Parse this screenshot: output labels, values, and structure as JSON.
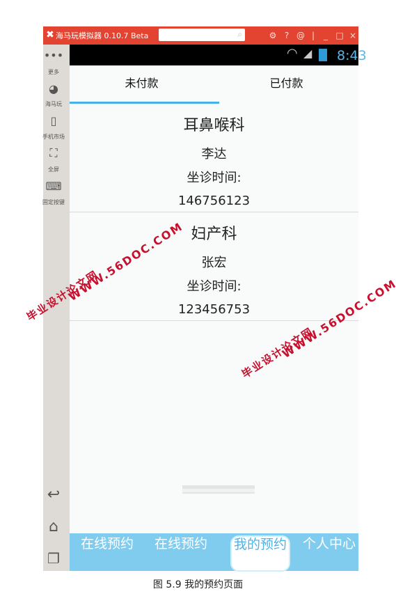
{
  "emulator": {
    "title": "海马玩模拟器 0.10.7 Beta",
    "search_placeholder": "",
    "controls": [
      "⚙",
      "?",
      "@",
      "|",
      "_",
      "□",
      "×"
    ],
    "rail": [
      {
        "icon": "more-icon",
        "label": "更多"
      },
      {
        "icon": "haima-icon",
        "label": "海马玩"
      },
      {
        "icon": "phone-market-icon",
        "label": "手机市场"
      },
      {
        "icon": "fullscreen-icon",
        "label": "全屏"
      },
      {
        "icon": "keymap-icon",
        "label": "固定按键"
      }
    ],
    "nav_icons": [
      "back-icon",
      "home-icon",
      "recents-icon"
    ]
  },
  "statusbar": {
    "time": "8:43"
  },
  "tabs": [
    {
      "label": "未付款",
      "active": true
    },
    {
      "label": "已付款",
      "active": false
    }
  ],
  "appointments": [
    {
      "department": "耳鼻喉科",
      "doctor": "李达",
      "time_label": "坐诊时间:",
      "time_value": "146756123"
    },
    {
      "department": "妇产科",
      "doctor": "张宏",
      "time_label": "坐诊时间:",
      "time_value": "123456753"
    }
  ],
  "bottom_nav": [
    {
      "label": "在线预约",
      "active": false
    },
    {
      "label": "在线预约",
      "active": false
    },
    {
      "label": "我的预约",
      "active": true
    },
    {
      "label": "个人中心",
      "active": false
    }
  ],
  "watermarks": [
    {
      "line1": "WWW.56DOC.COM",
      "line2": "毕业设计论文网"
    },
    {
      "line1": "WWW.56DOC.COM",
      "line2": "毕业设计论文网"
    }
  ],
  "caption": "图 5.9 我的预约页面",
  "colors": {
    "accent": "#46b2e8",
    "nav_bg": "#7fccef",
    "titlebar": "#e34331",
    "watermark": "#c8102e"
  }
}
